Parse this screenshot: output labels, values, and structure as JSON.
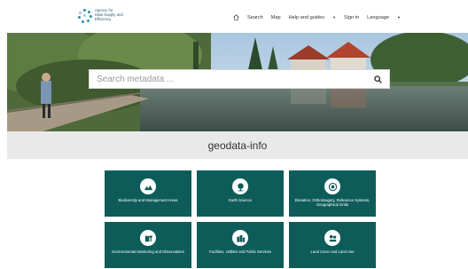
{
  "header": {
    "logo_lines": [
      "Agency for",
      "Data Supply and",
      "Efficiency"
    ],
    "nav": {
      "search": "Search",
      "map": "Map",
      "help": "Help and guides",
      "signin": "Sign in",
      "language": "Language"
    }
  },
  "search": {
    "placeholder": "Search metadata ..."
  },
  "page_title": "geodata-info",
  "tiles": [
    {
      "label": "Biodiversity and Management Areas",
      "icon": "landscape-icon"
    },
    {
      "label": "Earth Science",
      "icon": "globe-icon"
    },
    {
      "label": "Elevation, Orthoimagery, Reference Systems, Geographical Grids",
      "icon": "orbit-icon"
    },
    {
      "label": "Environmental Monitoring and Observations",
      "icon": "monitoring-icon"
    },
    {
      "label": "Facilities, Utilities and Public Services",
      "icon": "buildings-icon"
    },
    {
      "label": "Land Cover and Land Use",
      "icon": "land-use-icon"
    }
  ],
  "colors": {
    "tile_bg": "#0d5c5a",
    "band_bg": "#e9e9e9",
    "brand": "#2b8fa8"
  }
}
